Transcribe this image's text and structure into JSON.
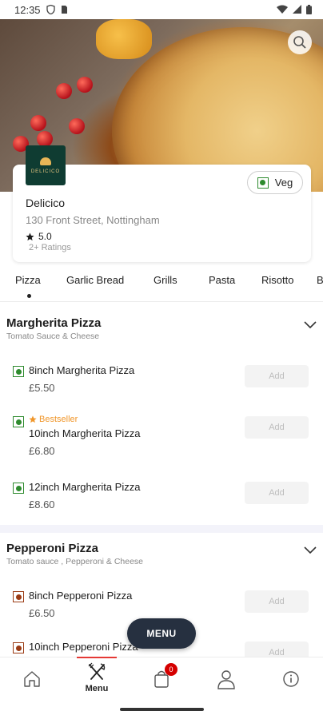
{
  "status_bar": {
    "time": "12:35"
  },
  "restaurant": {
    "logo_text": "DELICICO",
    "name": "Delicico",
    "address": "130 Front Street, Nottingham",
    "rating": "5.0",
    "ratings_count": "2+ Ratings",
    "veg_label": "Veg"
  },
  "tabs": [
    "Pizza",
    "Garlic Bread",
    "Grills",
    "Pasta",
    "Risotto",
    "B"
  ],
  "sections": [
    {
      "title": "Margherita Pizza",
      "subtitle": "Tomato Sauce & Cheese",
      "items": [
        {
          "name": "8inch Margherita Pizza",
          "price": "£5.50",
          "badge": "",
          "add_label": "Add"
        },
        {
          "name": "10inch Margherita Pizza",
          "price": "£6.80",
          "badge": "Bestseller",
          "add_label": "Add"
        },
        {
          "name": "12inch Margherita Pizza",
          "price": "£8.60",
          "badge": "",
          "add_label": "Add"
        }
      ]
    },
    {
      "title": "Pepperoni Pizza",
      "subtitle": "Tomato sauce , Pepperoni & Cheese",
      "items": [
        {
          "name": "8inch Pepperoni Pizza",
          "price": "£6.50",
          "badge": "",
          "add_label": "Add"
        },
        {
          "name": "10inch Pepperoni Pizza",
          "price": "",
          "badge": "",
          "add_label": "Add"
        }
      ]
    }
  ],
  "menu_button": "MENU",
  "bottom_nav": {
    "menu_label": "Menu",
    "cart_count": "0"
  },
  "colors": {
    "veg": "#2e8b2e",
    "nonveg": "#9b3b14",
    "bestseller": "#f0962a",
    "menu_button_bg": "#263040",
    "badge": "#d50000",
    "logo_bg": "#0f3c32"
  }
}
